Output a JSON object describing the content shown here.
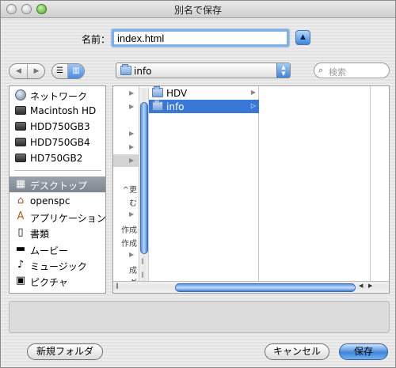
{
  "window": {
    "title": "別名で保存"
  },
  "name_row": {
    "label": "名前：",
    "value": "index.html"
  },
  "toolbar": {
    "location": "info",
    "search_placeholder": "検索"
  },
  "sidebar": {
    "devices": [
      {
        "label": "ネットワーク",
        "icon": "globe-icon"
      },
      {
        "label": "Macintosh HD",
        "icon": "hard-drive-icon"
      },
      {
        "label": "HDD750GB3",
        "icon": "hard-drive-icon"
      },
      {
        "label": "HDD750GB4",
        "icon": "hard-drive-icon"
      },
      {
        "label": "HD750GB2",
        "icon": "hard-drive-icon"
      }
    ],
    "places": [
      {
        "label": "デスクトップ",
        "icon": "desktop-icon",
        "selected": true
      },
      {
        "label": "openspc",
        "icon": "home-icon"
      },
      {
        "label": "アプリケーション",
        "icon": "applications-icon"
      },
      {
        "label": "書類",
        "icon": "documents-icon"
      },
      {
        "label": "ムービー",
        "icon": "movies-icon"
      },
      {
        "label": "ミュージック",
        "icon": "music-icon"
      },
      {
        "label": "ピクチャ",
        "icon": "pictures-icon"
      }
    ]
  },
  "browser": {
    "column0_stubs": [
      "^更",
      "む",
      "作成",
      "作成",
      "成",
      "ダ"
    ],
    "column1": [
      {
        "label": "HDV",
        "selected": false
      },
      {
        "label": "info",
        "selected": true
      }
    ]
  },
  "buttons": {
    "new_folder": "新規フォルダ",
    "cancel": "キャンセル",
    "save": "保存"
  },
  "colors": {
    "accent": "#3a78d8",
    "sidebar_selected": "#8a929c"
  }
}
